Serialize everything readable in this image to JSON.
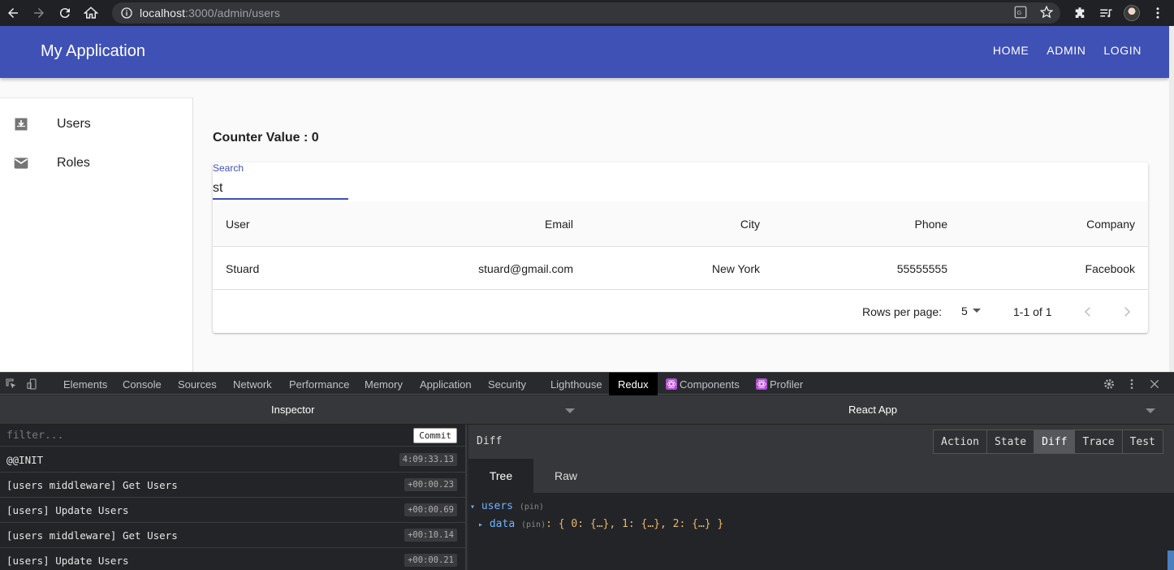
{
  "browser": {
    "url_host": "localhost",
    "url_path": ":3000/admin/users"
  },
  "appbar": {
    "title": "My Application",
    "nav": [
      "HOME",
      "ADMIN",
      "LOGIN"
    ],
    "color": "#3f51b5"
  },
  "sidebar": {
    "items": [
      {
        "label": "Users",
        "icon": "inbox-icon"
      },
      {
        "label": "Roles",
        "icon": "mail-icon"
      }
    ]
  },
  "main": {
    "counter_label": "Counter Value : 0",
    "search": {
      "label": "Search",
      "value": "st"
    },
    "table": {
      "columns": [
        "User",
        "Email",
        "City",
        "Phone",
        "Company"
      ],
      "rows": [
        {
          "user": "Stuard",
          "email": "stuard@gmail.com",
          "city": "New York",
          "phone": "55555555",
          "company": "Facebook"
        }
      ]
    },
    "pagination": {
      "rows_per_page_label": "Rows per page:",
      "rows_per_page": "5",
      "range": "1-1 of 1"
    }
  },
  "devtools": {
    "tabs": [
      "Elements",
      "Console",
      "Sources",
      "Network",
      "Performance",
      "Memory",
      "Application",
      "Security",
      "Lighthouse",
      "Redux",
      "Components",
      "Profiler"
    ],
    "active_tab": "Redux",
    "inspector_label": "Inspector",
    "app_selector": "React App",
    "filter_placeholder": "filter...",
    "commit_label": "Commit",
    "actions": [
      {
        "name": "@@INIT",
        "time": "4:09:33.13"
      },
      {
        "name": "[users middleware] Get Users",
        "time": "+00:00.23"
      },
      {
        "name": "[users] Update Users",
        "time": "+00:00.69"
      },
      {
        "name": "[users middleware] Get Users",
        "time": "+00:10.14"
      },
      {
        "name": "[users] Update Users",
        "time": "+00:00.21"
      }
    ],
    "panel_title": "Diff",
    "panel_modes": [
      "Action",
      "State",
      "Diff",
      "Trace",
      "Test"
    ],
    "active_mode": "Diff",
    "view_tabs": [
      "Tree",
      "Raw"
    ],
    "active_view": "Tree",
    "tree": {
      "root_key": "users",
      "pin": "(pin)",
      "child_key": "data",
      "child_pin": "(pin)",
      "child_value": ": { 0: {…}, 1: {…}, 2: {…} }"
    }
  }
}
